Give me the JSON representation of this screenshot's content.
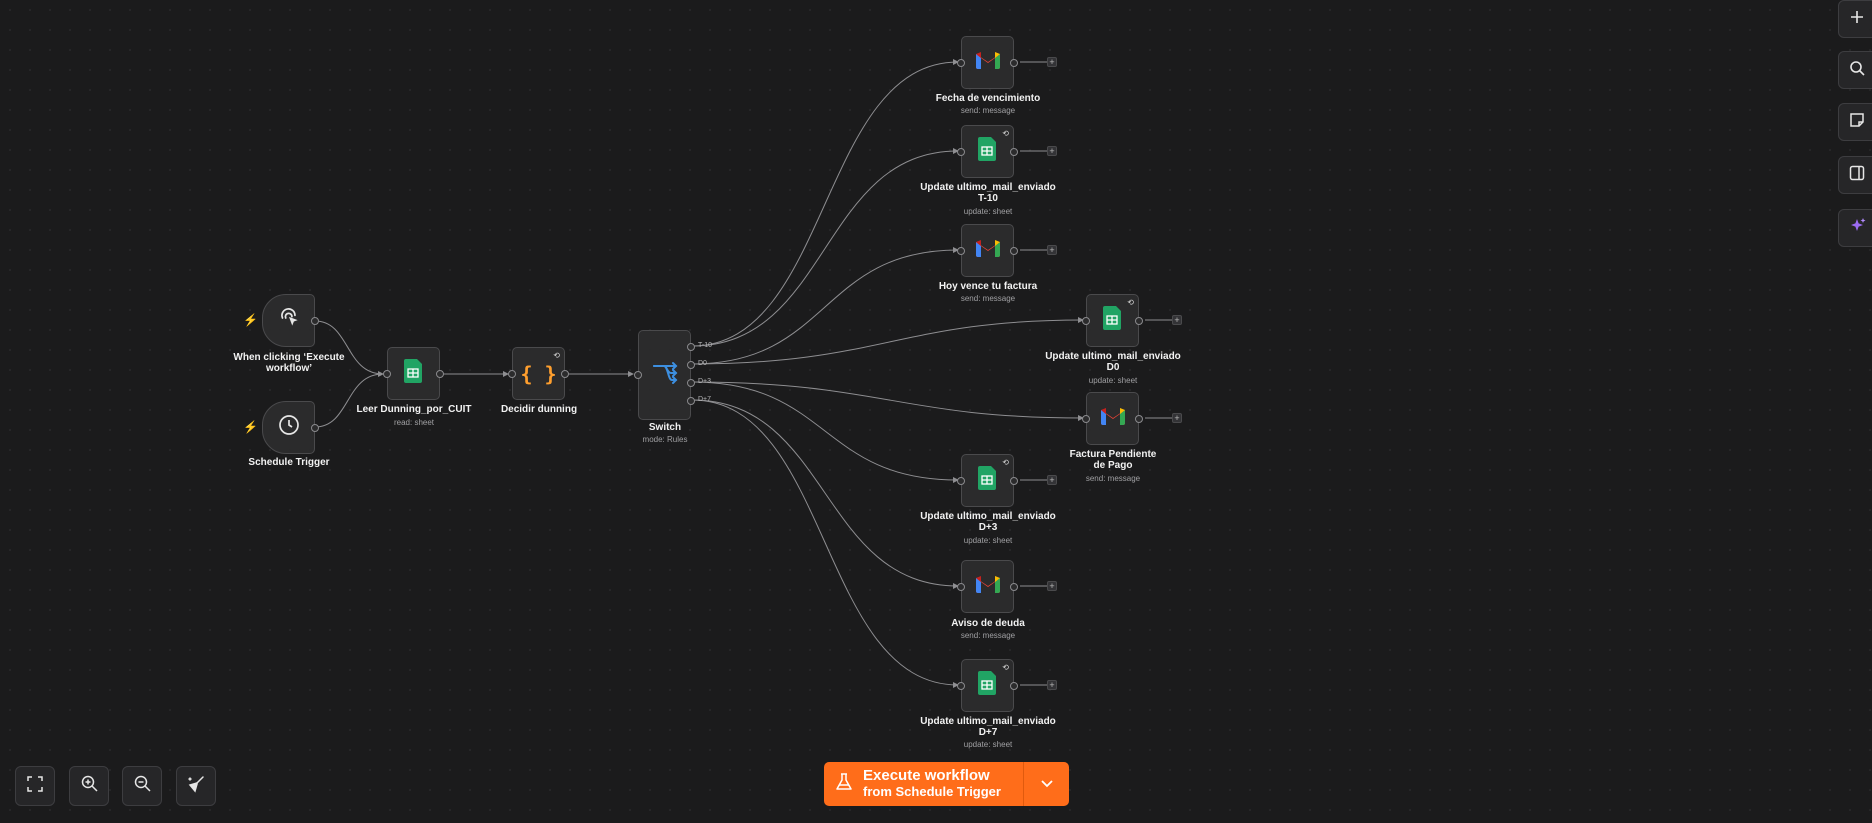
{
  "canvas": {
    "nodes": [
      {
        "id": "manual_trigger",
        "label": "When clicking ‘Execute workflow’",
        "subtitle": "",
        "icon": "pointer-click-icon",
        "kind": "trigger"
      },
      {
        "id": "schedule_trigger",
        "label": "Schedule Trigger",
        "subtitle": "",
        "icon": "clock-icon",
        "kind": "trigger"
      },
      {
        "id": "leer_dunning",
        "label": "Leer Dunning_por_CUIT",
        "subtitle": "read: sheet",
        "icon": "google-sheets-icon"
      },
      {
        "id": "decidir_dunning",
        "label": "Decidir dunning",
        "subtitle": "",
        "icon": "code-braces-icon"
      },
      {
        "id": "switch",
        "label": "Switch",
        "subtitle": "mode: Rules",
        "icon": "switch-icon",
        "outputs": [
          "T-10",
          "D0",
          "D+3",
          "D+7"
        ]
      },
      {
        "id": "fecha_venc",
        "label": "Fecha de vencimiento",
        "subtitle": "send: message",
        "icon": "gmail-icon"
      },
      {
        "id": "update_t10",
        "label": "Update ultimo_mail_enviado T-10",
        "subtitle": "update: sheet",
        "icon": "google-sheets-icon"
      },
      {
        "id": "hoy_vence",
        "label": "Hoy vence tu factura",
        "subtitle": "send: message",
        "icon": "gmail-icon"
      },
      {
        "id": "update_d0",
        "label": "Update ultimo_mail_enviado D0",
        "subtitle": "update: sheet",
        "icon": "google-sheets-icon"
      },
      {
        "id": "factura_pendiente",
        "label": "Factura Pendiente de Pago",
        "subtitle": "send: message",
        "icon": "gmail-icon"
      },
      {
        "id": "update_d3",
        "label": "Update ultimo_mail_enviado D+3",
        "subtitle": "update: sheet",
        "icon": "google-sheets-icon"
      },
      {
        "id": "aviso_deuda",
        "label": "Aviso de deuda",
        "subtitle": "send: message",
        "icon": "gmail-icon"
      },
      {
        "id": "update_d7",
        "label": "Update ultimo_mail_enviado D+7",
        "subtitle": "update: sheet",
        "icon": "google-sheets-icon"
      }
    ]
  },
  "toolbar": {
    "buttons": [
      "fit-view",
      "zoom-in",
      "zoom-out",
      "tidy-up"
    ]
  },
  "sidebar": {
    "buttons": [
      "add-node",
      "search",
      "sticky-note",
      "toggle-panel",
      "ai-assistant"
    ]
  },
  "execute": {
    "title": "Execute workflow",
    "subtitle": "from Schedule Trigger"
  },
  "colors": {
    "accent": "#ff6d1a",
    "canvas_bg": "#1b1b1c",
    "node_bg": "#2b2b2c",
    "switch_icon": "#3d8fe0",
    "code_icon": "#ff9f2e",
    "sheets_green": "#21a464"
  }
}
